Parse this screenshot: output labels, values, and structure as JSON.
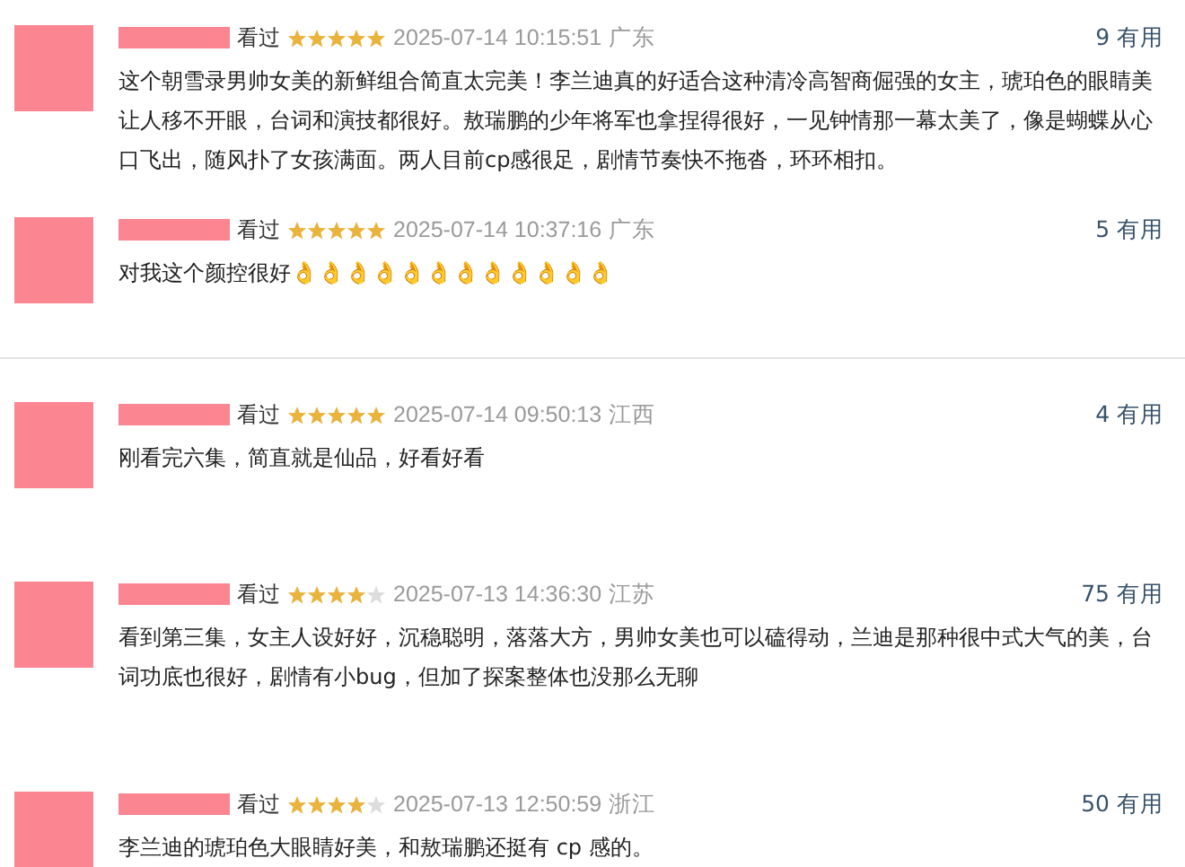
{
  "reviews": [
    {
      "status": "看过",
      "stars": 5,
      "time": "2025-07-14 10:15:51",
      "region": "广东",
      "useful": "9 有用",
      "text": "这个朝雪录男帅女美的新鲜组合简直太完美！李兰迪真的好适合这种清冷高智商倔强的女主，琥珀色的眼睛美让人移不开眼，台词和演技都很好。敖瑞鹏的少年将军也拿捏得很好，一见钟情那一幕太美了，像是蝴蝶从心口飞出，随风扑了女孩满面。两人目前cp感很足，剧情节奏快不拖沓，环环相扣。"
    },
    {
      "status": "看过",
      "stars": 5,
      "time": "2025-07-14 10:37:16",
      "region": "广东",
      "useful": "5 有用",
      "text": "对我这个颜控很好👌👌👌👌👌👌👌👌👌👌👌👌"
    },
    {
      "status": "看过",
      "stars": 5,
      "time": "2025-07-14 09:50:13",
      "region": "江西",
      "useful": "4 有用",
      "text": "刚看完六集，简直就是仙品，好看好看"
    },
    {
      "status": "看过",
      "stars": 4,
      "time": "2025-07-13 14:36:30",
      "region": "江苏",
      "useful": "75 有用",
      "text": "看到第三集，女主人设好好，沉稳聪明，落落大方，男帅女美也可以磕得动，兰迪是那种很中式大气的美，台词功底也很好，剧情有小bug，但加了探案整体也没那么无聊"
    },
    {
      "status": "看过",
      "stars": 4,
      "time": "2025-07-13 12:50:59",
      "region": "浙江",
      "useful": "50 有用",
      "text": "李兰迪的琥珀色大眼睛好美，和敖瑞鹏还挺有 cp 感的。"
    }
  ]
}
